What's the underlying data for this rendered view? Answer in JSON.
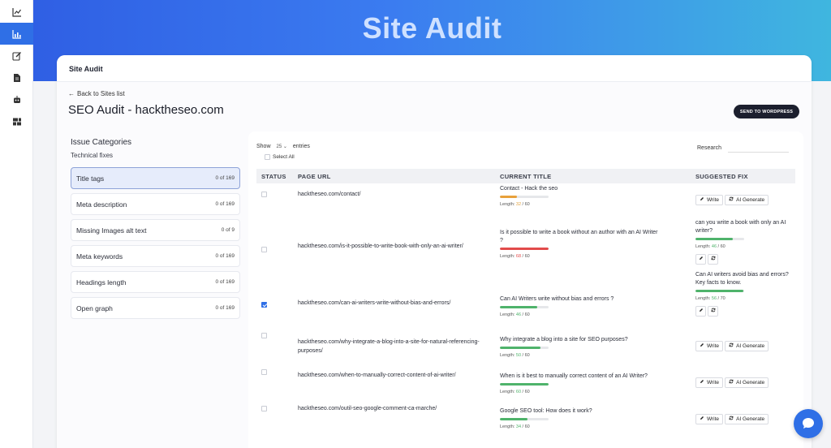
{
  "hero": {
    "title": "Site Audit"
  },
  "card": {
    "header": "Site Audit",
    "back_label": "Back to Sites list",
    "page_title": "SEO Audit - hacktheseo.com",
    "send_button": "SEND TO WORDPRESS"
  },
  "issues": {
    "title": "Issue Categories",
    "subtitle": "Technical fixes",
    "items": [
      {
        "label": "Title tags",
        "count": "0 of 169"
      },
      {
        "label": "Meta description",
        "count": "0 of 169"
      },
      {
        "label": "Missing Images alt text",
        "count": "0 of 9"
      },
      {
        "label": "Meta keywords",
        "count": "0 of 169"
      },
      {
        "label": "Headings length",
        "count": "0 of 169"
      },
      {
        "label": "Open graph",
        "count": "0 of 169"
      }
    ]
  },
  "table": {
    "show_label": "Show",
    "show_value": "25",
    "entries_label": "entries",
    "select_all": "Select All",
    "research_label": "Research",
    "columns": [
      "STATUS",
      "PAGE URL",
      "CURRENT TITLE",
      "SUGGESTED FIX"
    ],
    "length_prefix": "Length:",
    "write_label": "Write",
    "ai_label": "AI Generate",
    "rows": [
      {
        "url": "hacktheseo.com/contact/",
        "title": "Contact - Hack the seo",
        "len": "32",
        "max": "60",
        "fill": 0.35,
        "color": "#e8a13a",
        "lencls": "",
        "checked": false,
        "fix_type": "buttons"
      },
      {
        "url": "hacktheseo.com/is-it-possible-to-write-book-with-only-an-ai-writer/",
        "title": "Is it possible to write a book without an author with an AI Writer ?",
        "len": "68",
        "max": "60",
        "fill": 1.0,
        "color": "#e24b4b",
        "lencls": "red",
        "checked": false,
        "fix_type": "suggest",
        "fix_text": "can you write a book with only an AI writer?",
        "fix_len": "46",
        "fix_max": "60",
        "fix_fill": 0.76
      },
      {
        "url": "hacktheseo.com/can-ai-writers-write-without-bias-and-errors/",
        "title": "Can AI Writers write without bias and errors ?",
        "len": "46",
        "max": "60",
        "fill": 0.76,
        "color": "#4fb36b",
        "lencls": "green",
        "checked": true,
        "fix_type": "suggest",
        "fix_text": "Can AI writers avoid bias and errors? Key facts to know.",
        "fix_len": "56",
        "fix_max": "70",
        "fix_fill": 0.98
      },
      {
        "url": "hacktheseo.com/why-integrate-a-blog-into-a-site-for-natural-referencing-purposes/",
        "title": "Why integrate a blog into a site for SEO purposes?",
        "len": "50",
        "max": "60",
        "fill": 0.83,
        "color": "#4fb36b",
        "lencls": "green",
        "checked": false,
        "fix_type": "buttons"
      },
      {
        "url": "hacktheseo.com/when-to-manually-correct-content-of-ai-writer/",
        "title": "When is it best to manually correct content of an AI Writer?",
        "len": "60",
        "max": "60",
        "fill": 1.0,
        "color": "#4fb36b",
        "lencls": "green",
        "checked": false,
        "fix_type": "buttons"
      },
      {
        "url": "hacktheseo.com/outil-seo-google-comment-ca-marche/",
        "title": "Google SEO tool: How does it work?",
        "len": "34",
        "max": "60",
        "fill": 0.57,
        "color": "#4fb36b",
        "lencls": "green",
        "checked": false,
        "fix_type": "buttons"
      }
    ]
  }
}
